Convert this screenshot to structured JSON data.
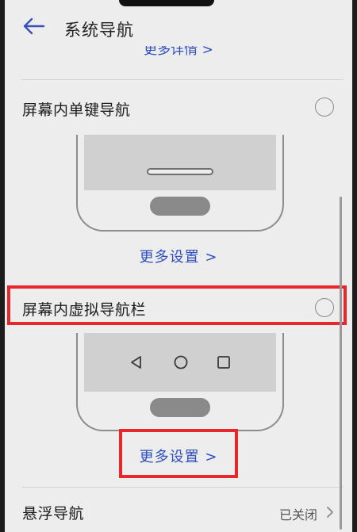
{
  "header": {
    "title": "系统导航",
    "back_icon": "arrow-left-icon"
  },
  "top_partial_link": "更多详情 >",
  "options": [
    {
      "label": "屏幕内单键导航",
      "more_link": "更多设置 >"
    },
    {
      "label": "屏幕内虚拟导航栏",
      "more_link": "更多设置 >"
    }
  ],
  "floating_nav": {
    "label": "悬浮导航",
    "value": "已关闭"
  },
  "colors": {
    "accent": "#2f4fbf",
    "highlight": "#e8262c",
    "background": "#ededed"
  },
  "icons": {
    "nav_back": "triangle-back-icon",
    "nav_home": "circle-home-icon",
    "nav_recent": "square-recent-icon",
    "chevron": "chevron-right-icon"
  }
}
